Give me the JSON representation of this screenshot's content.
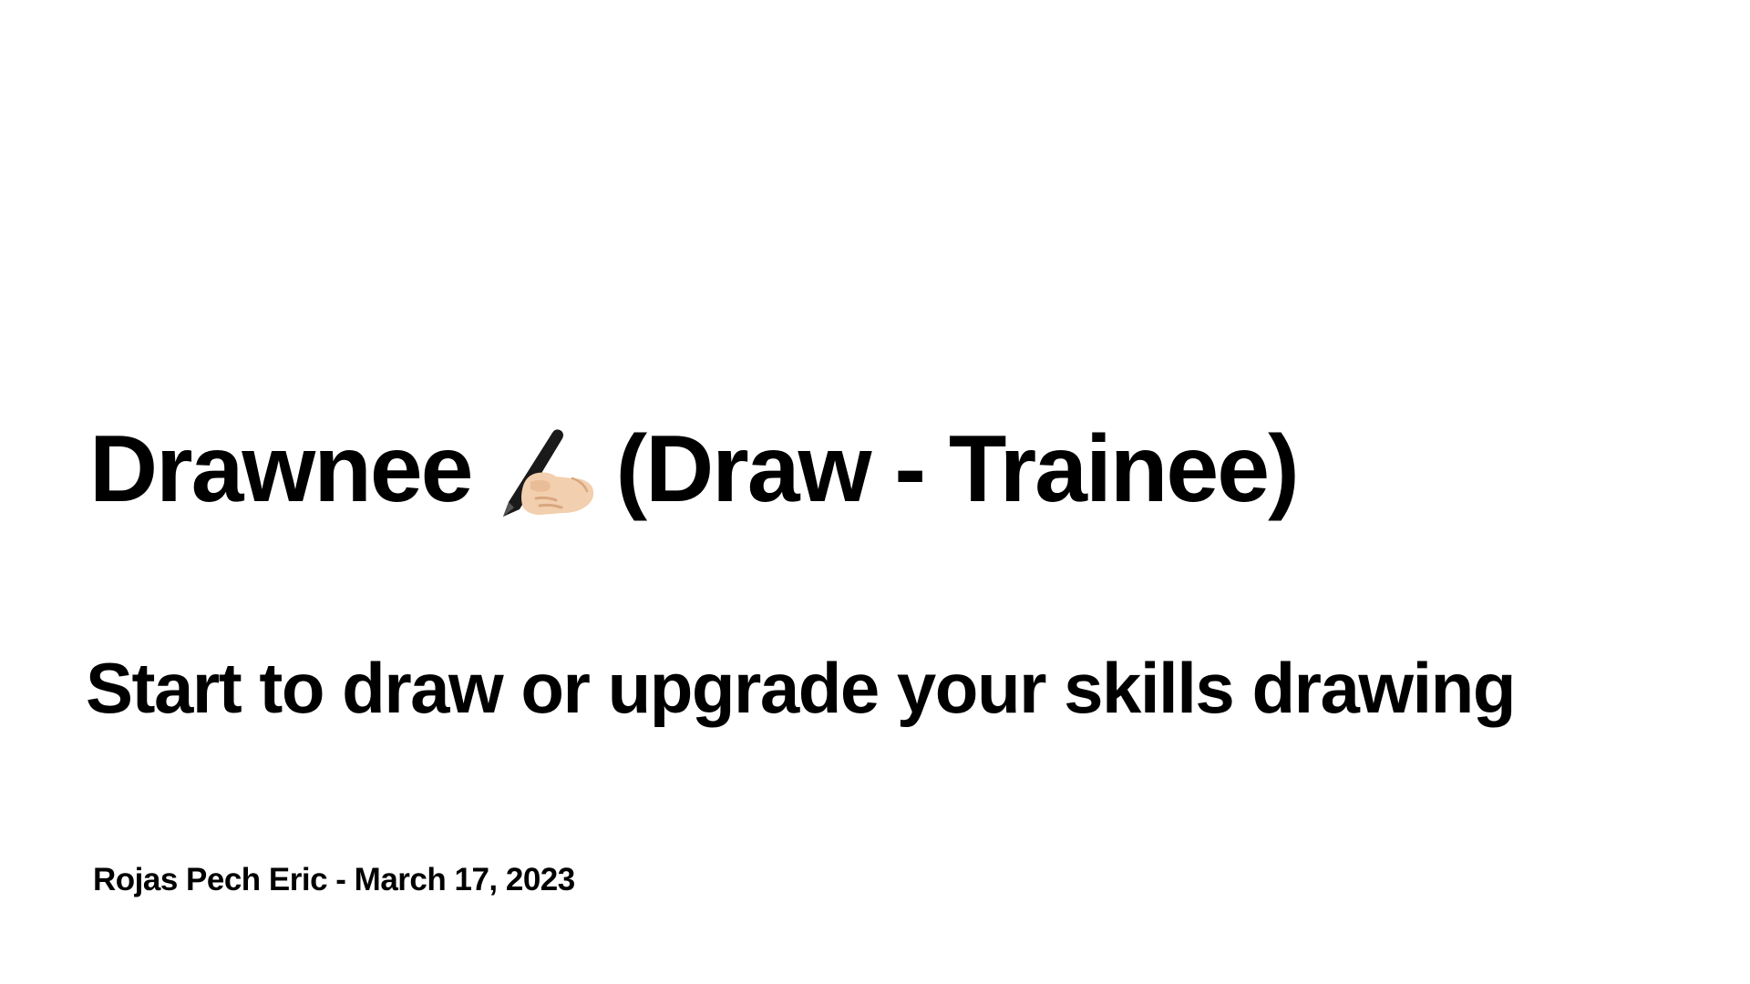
{
  "slide": {
    "title_prefix": "Drawnee",
    "title_icon": "writing-hand-icon",
    "title_suffix": "(Draw - Trainee)",
    "subtitle": "Start to draw or upgrade your skills drawing",
    "byline": "Rojas Pech Eric - March 17, 2023"
  },
  "colors": {
    "background": "#ffffff",
    "text": "#000000",
    "skin": "#f2cfae",
    "pen": "#1a1a1a"
  }
}
